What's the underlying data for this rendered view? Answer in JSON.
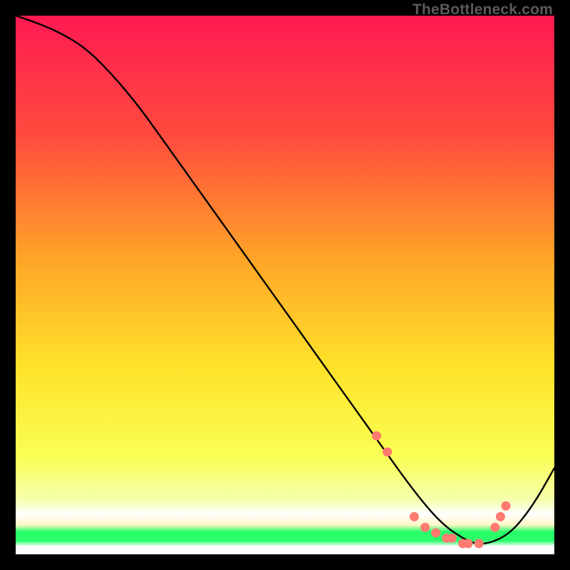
{
  "watermark": "TheBottleneck.com",
  "chart_data": {
    "type": "line",
    "title": "",
    "xlabel": "",
    "ylabel": "",
    "xlim": [
      0,
      100
    ],
    "ylim": [
      0,
      100
    ],
    "grid": false,
    "series": [
      {
        "name": "curve",
        "color": "#000000",
        "x": [
          0,
          3,
          8,
          13,
          18,
          23,
          28,
          33,
          38,
          43,
          48,
          53,
          58,
          63,
          68,
          73,
          77,
          80,
          83,
          85,
          88,
          92,
          96,
          100
        ],
        "y": [
          100,
          99,
          97,
          94,
          89,
          83,
          76,
          69,
          62,
          55,
          48,
          41,
          34,
          27,
          20,
          13,
          8,
          5,
          3,
          2,
          2,
          4,
          9,
          16
        ]
      }
    ],
    "highlight_points": {
      "name": "dots",
      "color": "#ff7a70",
      "x": [
        67,
        69,
        74,
        76,
        78,
        80,
        81,
        83,
        84,
        86,
        89,
        90,
        91
      ],
      "y": [
        22,
        19,
        7,
        5,
        4,
        3,
        3,
        2,
        2,
        2,
        5,
        7,
        9
      ]
    },
    "background_gradient": {
      "top": "#ff1a52",
      "mid_upper": "#ff9a2a",
      "mid": "#ffe82a",
      "mid_lower": "#f7ff70",
      "green_band": "#2aff6a",
      "bottom_pale": "#fff7c8"
    }
  }
}
